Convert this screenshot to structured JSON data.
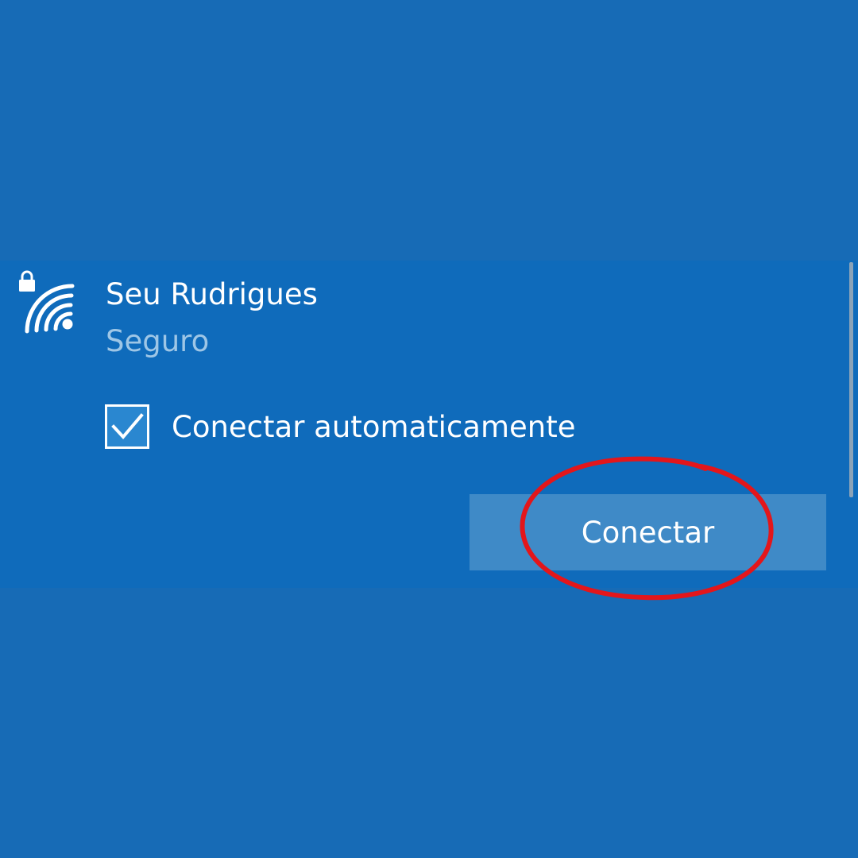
{
  "network": {
    "name": "Seu Rudrigues",
    "status": "Seguro",
    "icons": {
      "signal": "wifi-icon",
      "security": "lock-icon"
    }
  },
  "auto_connect": {
    "label": "Conectar automaticamente",
    "checked": true
  },
  "connect_button": {
    "label": "Conectar"
  },
  "annotation": {
    "type": "hand-drawn-ellipse",
    "color": "#e02020"
  },
  "colors": {
    "background": "#176bb6",
    "panel": "#0f6bbb",
    "button": "#3f8ac7",
    "status_text": "#9ec6e6"
  }
}
